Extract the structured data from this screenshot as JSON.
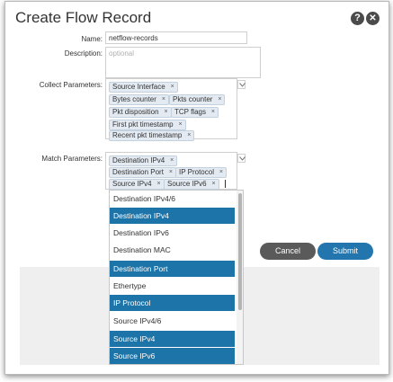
{
  "dialog": {
    "title": "Create Flow Record",
    "help_glyph": "?",
    "close_glyph": "✕"
  },
  "form": {
    "name_label": "Name:",
    "name_value": "netflow-records",
    "description_label": "Description:",
    "description_placeholder": "optional",
    "collect_label": "Collect Parameters:",
    "collect_tags": [
      "Source Interface",
      "Bytes counter",
      "Pkts counter",
      "Pkt disposition",
      "TCP flags",
      "First pkt timestamp",
      "Recent pkt timestamp"
    ],
    "match_label": "Match Parameters:",
    "match_tags": [
      "Destination IPv4",
      "Destination Port",
      "IP Protocol",
      "Source IPv4",
      "Source IPv6"
    ],
    "tag_remove_glyph": "×"
  },
  "dropdown": {
    "options": [
      {
        "label": "Destination IPv4/6",
        "selected": false
      },
      {
        "label": "Destination IPv4",
        "selected": true
      },
      {
        "label": "Destination IPv6",
        "selected": false
      },
      {
        "label": "Destination MAC",
        "selected": false
      },
      {
        "label": "Destination Port",
        "selected": true
      },
      {
        "label": "Ethertype",
        "selected": false
      },
      {
        "label": "IP Protocol",
        "selected": true
      },
      {
        "label": "Source IPv4/6",
        "selected": false
      },
      {
        "label": "Source IPv4",
        "selected": true
      },
      {
        "label": "Source IPv6",
        "selected": true
      }
    ]
  },
  "buttons": {
    "cancel_label": "Cancel",
    "submit_label": "Submit"
  },
  "colors": {
    "accent": "#2275ad",
    "selected_option": "#1d74a8",
    "cancel_button": "#5a5a5a"
  }
}
